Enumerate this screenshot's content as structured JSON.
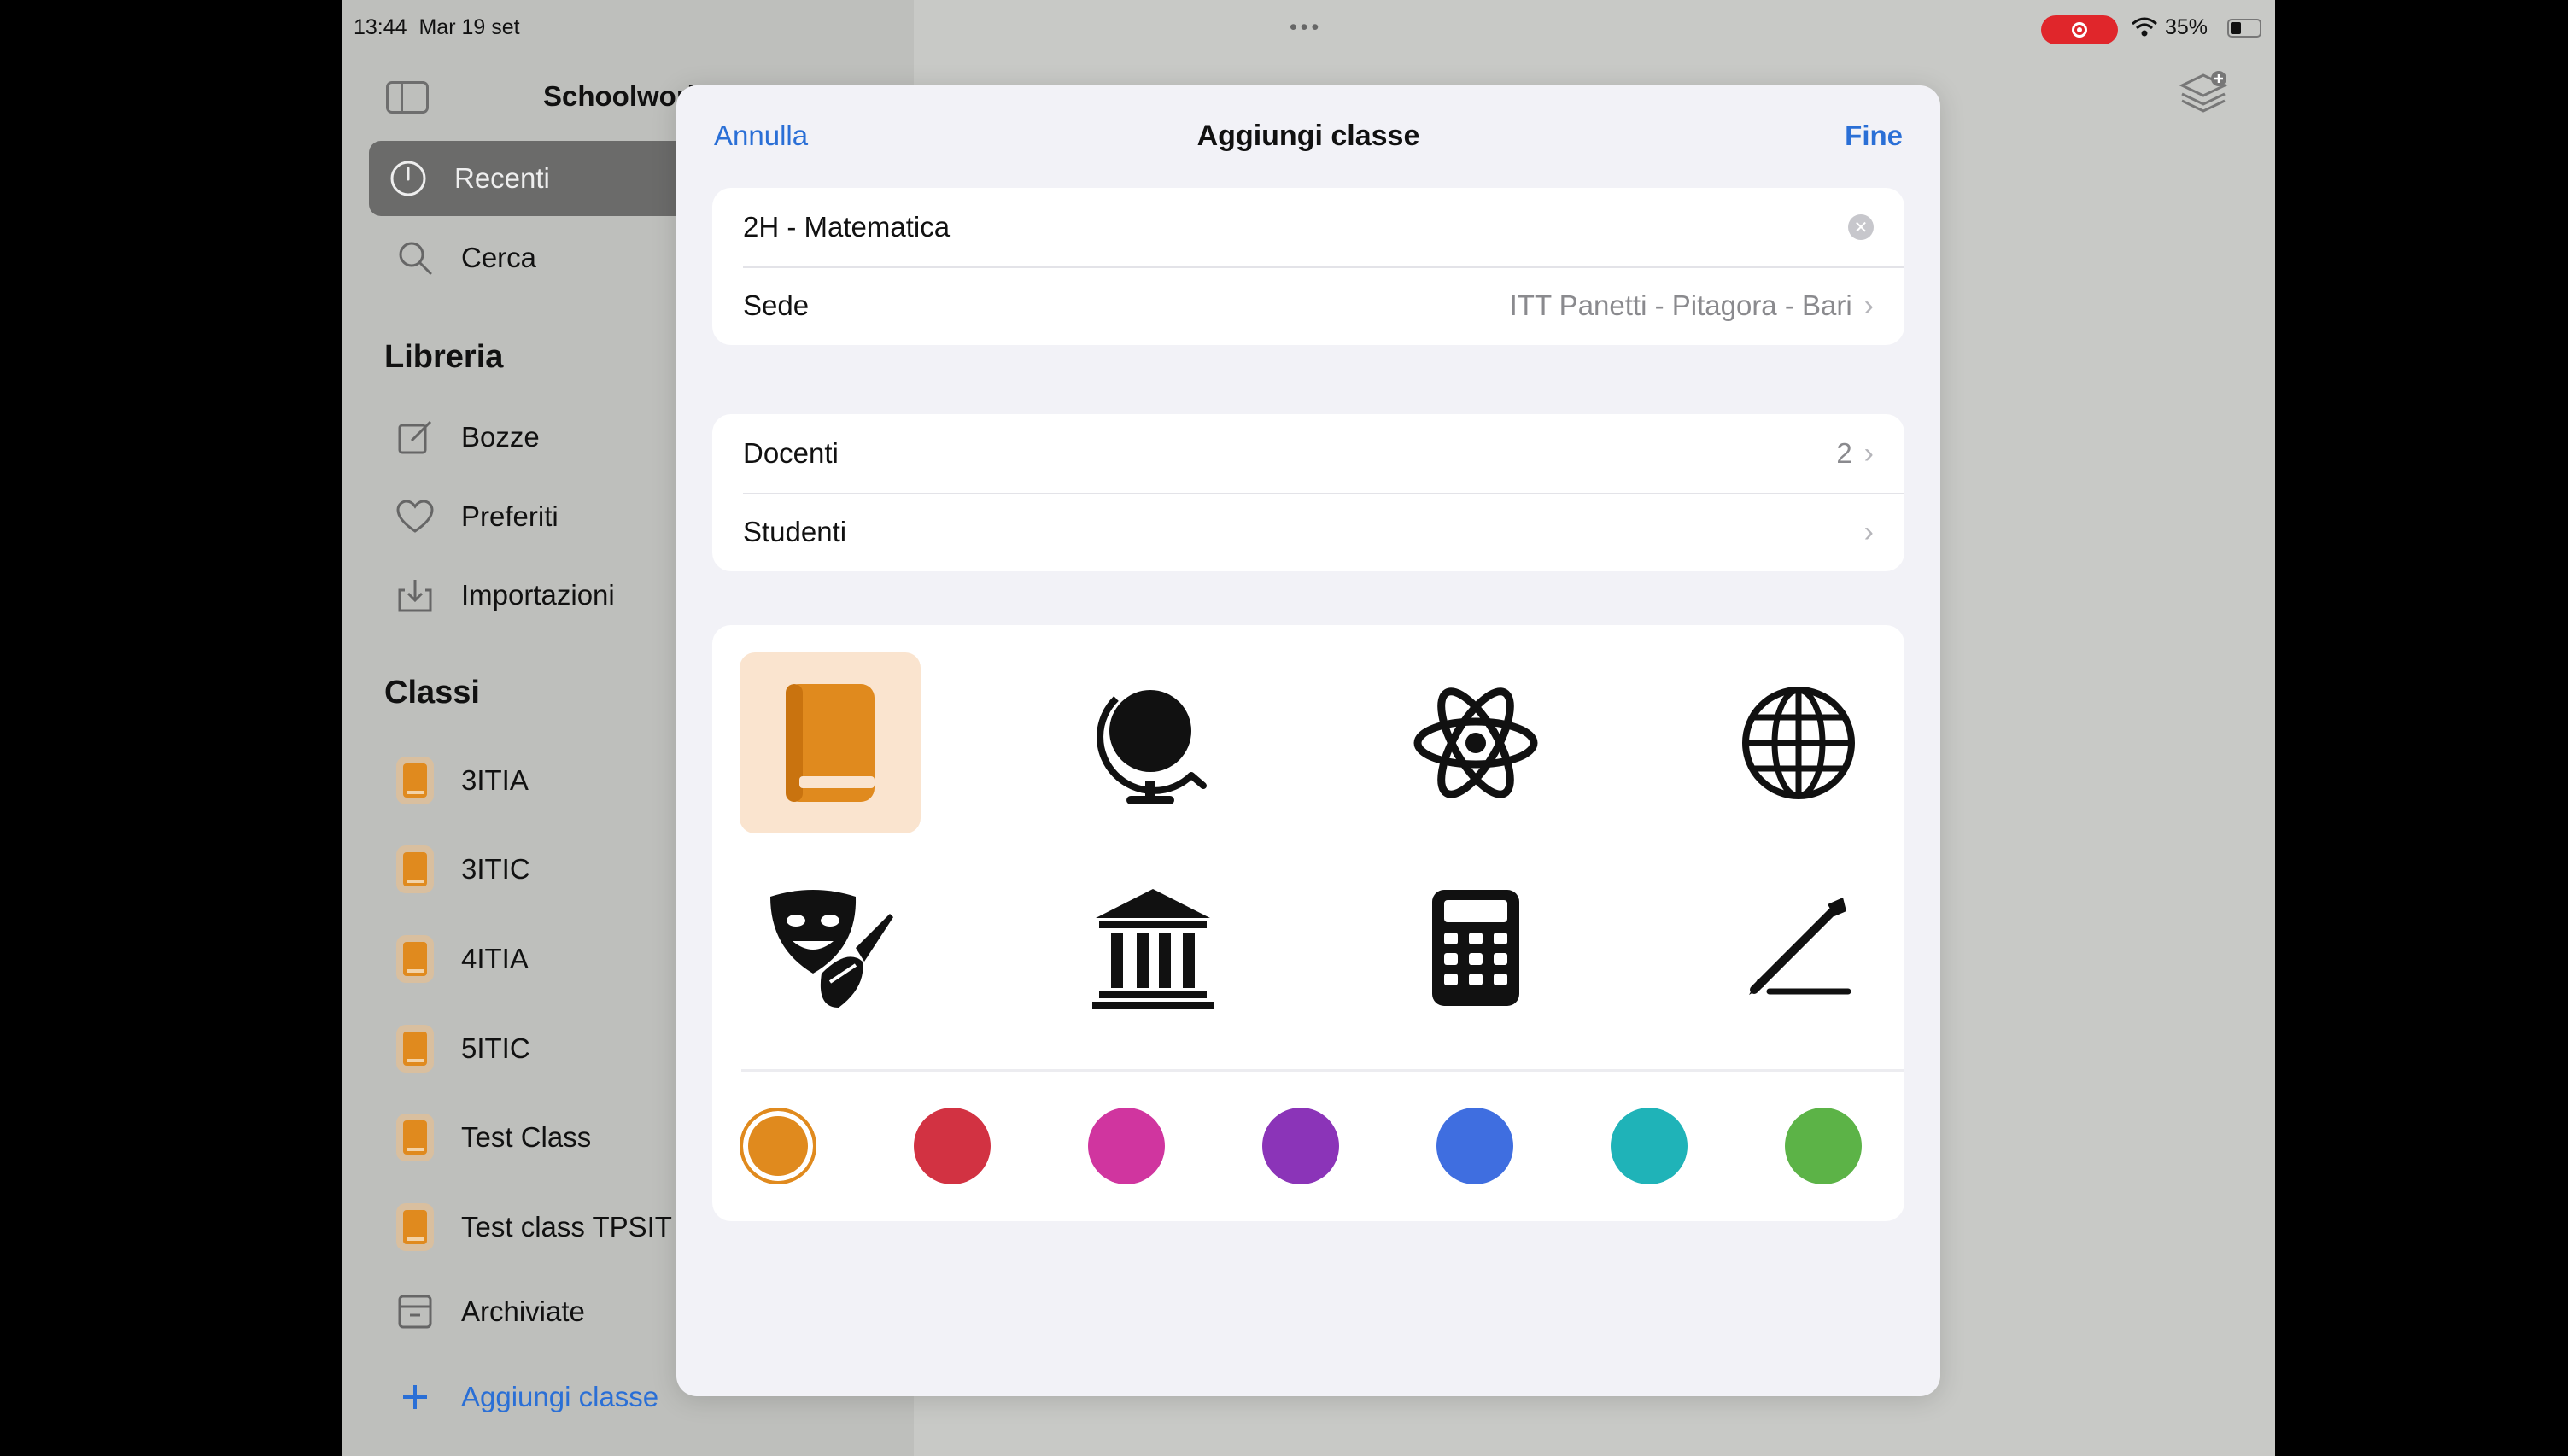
{
  "status_bar": {
    "time": "13:44",
    "date": "Mar 19 set",
    "dots": "•••",
    "battery": "35%"
  },
  "sidebar": {
    "app_title": "Schoolwork",
    "items": [
      {
        "label": "Recenti",
        "icon": "clock-icon",
        "active": true
      },
      {
        "label": "Cerca",
        "icon": "search-icon"
      }
    ],
    "library_header": "Libreria",
    "library": [
      {
        "label": "Bozze",
        "icon": "compose-icon"
      },
      {
        "label": "Preferiti",
        "icon": "heart-icon"
      },
      {
        "label": "Importazioni",
        "icon": "import-icon"
      }
    ],
    "classes_header": "Classi",
    "classes": [
      {
        "label": "3ITIA",
        "icon": "book-icon"
      },
      {
        "label": "3ITIC",
        "icon": "book-icon"
      },
      {
        "label": "4ITIA",
        "icon": "book-icon"
      },
      {
        "label": "5ITIC",
        "icon": "book-icon"
      },
      {
        "label": "Test Class",
        "icon": "book-icon"
      },
      {
        "label": "Test class TPSIT",
        "icon": "book-icon"
      }
    ],
    "archived": {
      "label": "Archiviate",
      "icon": "archive-icon"
    },
    "add_class": {
      "label": "Aggiungi classe",
      "icon": "plus-icon"
    }
  },
  "modal": {
    "cancel_label": "Annulla",
    "title": "Aggiungi classe",
    "done_label": "Fine",
    "class_name_value": "2H - Matematica",
    "location_label": "Sede",
    "location_value": "ITT Panetti - Pitagora - Bari",
    "teachers_label": "Docenti",
    "teachers_count": "2",
    "students_label": "Studenti",
    "icons": [
      "book-icon",
      "globe-stand-icon",
      "atom-icon",
      "globe-icon",
      "theater-masks-icon",
      "museum-icon",
      "calculator-icon",
      "pen-line-icon"
    ],
    "selected_icon": "book-icon",
    "colors": [
      "#e08a1e",
      "#d23242",
      "#d0359f",
      "#8b34b8",
      "#3f6ee0",
      "#1fb3b8",
      "#5cb347"
    ],
    "selected_color": "#e08a1e"
  }
}
